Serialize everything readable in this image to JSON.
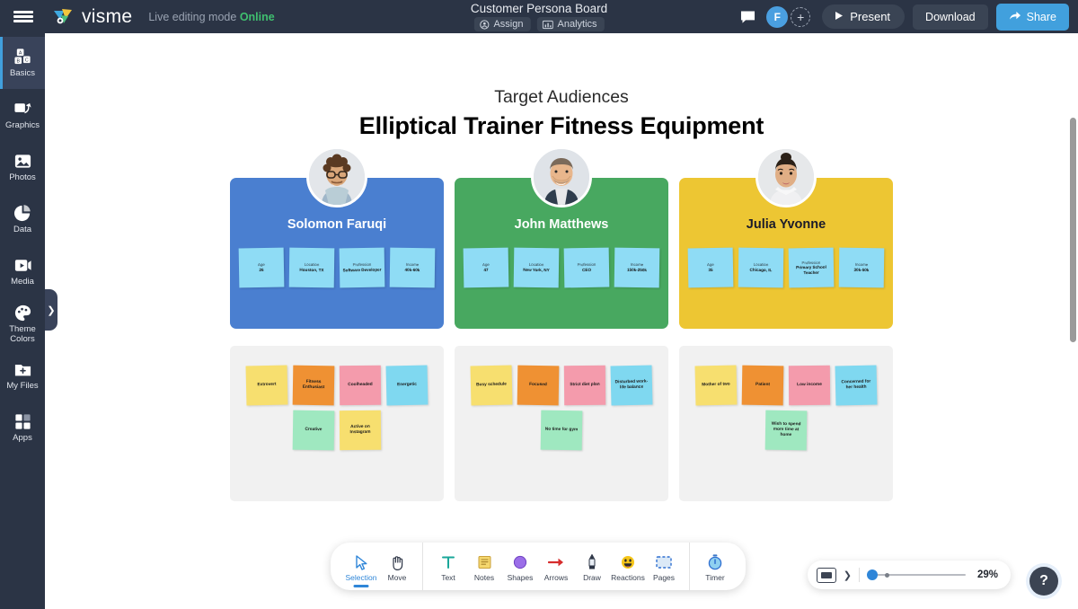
{
  "header": {
    "menu_icon": "hamburger-icon",
    "brand": "visme",
    "live_mode_prefix": "Live editing mode",
    "live_mode_status": "Online",
    "doc_title": "Customer Persona Board",
    "assign_label": "Assign",
    "analytics_label": "Analytics",
    "comment_icon": "comment-icon",
    "avatar_initial": "F",
    "add_user_icon": "add-user-icon",
    "present_label": "Present",
    "download_label": "Download",
    "share_label": "Share",
    "accent_blue": "#41a0dd",
    "bar_color": "#2b3445"
  },
  "sidebar": {
    "items": [
      {
        "label": "Basics",
        "icon": "blocks-icon",
        "active": true
      },
      {
        "label": "Graphics",
        "icon": "graphics-icon",
        "active": false
      },
      {
        "label": "Photos",
        "icon": "photo-icon",
        "active": false
      },
      {
        "label": "Data",
        "icon": "pie-chart-icon",
        "active": false
      },
      {
        "label": "Media",
        "icon": "video-icon",
        "active": false
      },
      {
        "label": "Theme Colors",
        "icon": "palette-icon",
        "active": false
      },
      {
        "label": "My Files",
        "icon": "folder-plus-icon",
        "active": false
      },
      {
        "label": "Apps",
        "icon": "apps-grid-icon",
        "active": false
      }
    ],
    "expand_icon": "chevron-right-icon"
  },
  "board": {
    "subtitle": "Target Audiences",
    "title": "Elliptical Trainer Fitness Equipment",
    "personas": [
      {
        "name": "Solomon Faruqi",
        "color": "#4a7fd0",
        "attributes": [
          {
            "key": "Age",
            "value": "26"
          },
          {
            "key": "Location",
            "value": "Houston, TX"
          },
          {
            "key": "Profession",
            "value": "Software Developer"
          },
          {
            "key": "Income",
            "value": "40k-60k"
          }
        ]
      },
      {
        "name": "John Matthews",
        "color": "#48a860",
        "attributes": [
          {
            "key": "Age",
            "value": "47"
          },
          {
            "key": "Location",
            "value": "New York, NY"
          },
          {
            "key": "Profession",
            "value": "CEO"
          },
          {
            "key": "Income",
            "value": "150k-250k"
          }
        ]
      },
      {
        "name": "Julia Yvonne",
        "color": "#edc633",
        "attributes": [
          {
            "key": "Age",
            "value": "35"
          },
          {
            "key": "Location",
            "value": "Chicago, IL"
          },
          {
            "key": "Profession",
            "value": "Primary School Teacher"
          },
          {
            "key": "Income",
            "value": "30k-50k"
          }
        ]
      }
    ],
    "trait_panels": [
      {
        "traits": [
          {
            "text": "Extrovert",
            "color": "#f7df6f"
          },
          {
            "text": "Fitness Enthusiast",
            "color": "#ef9133"
          },
          {
            "text": "Coolheaded",
            "color": "#f49bac"
          },
          {
            "text": "Energetic",
            "color": "#7fd8f0"
          },
          {
            "text": "Creative",
            "color": "#9fe8c0"
          },
          {
            "text": "Active on Instagram",
            "color": "#f7df6f"
          }
        ]
      },
      {
        "traits": [
          {
            "text": "Busy schedule",
            "color": "#f7df6f"
          },
          {
            "text": "Focused",
            "color": "#ef9133"
          },
          {
            "text": "Strict diet plan",
            "color": "#f49bac"
          },
          {
            "text": "Disturbed work-life balance",
            "color": "#7fd8f0"
          },
          {
            "text": "No time for gym",
            "color": "#9fe8c0"
          }
        ]
      },
      {
        "traits": [
          {
            "text": "Mother of two",
            "color": "#f7df6f"
          },
          {
            "text": "Patient",
            "color": "#ef9133"
          },
          {
            "text": "Low income",
            "color": "#f49bac"
          },
          {
            "text": "Concerned for her health",
            "color": "#7fd8f0"
          },
          {
            "text": "Wish to spend more time at home",
            "color": "#9fe8c0"
          }
        ]
      }
    ]
  },
  "toolbar": {
    "groups": [
      {
        "tools": [
          {
            "label": "Selection",
            "icon": "cursor-icon",
            "active": true
          },
          {
            "label": "Move",
            "icon": "hand-icon",
            "active": false
          }
        ]
      },
      {
        "tools": [
          {
            "label": "Text",
            "icon": "text-t-icon",
            "active": false
          },
          {
            "label": "Notes",
            "icon": "sticky-note-icon",
            "active": false
          },
          {
            "label": "Shapes",
            "icon": "circle-shape-icon",
            "active": false
          },
          {
            "label": "Arrows",
            "icon": "arrow-right-icon",
            "active": false
          },
          {
            "label": "Draw",
            "icon": "pen-icon",
            "active": false
          },
          {
            "label": "Reactions",
            "icon": "emoji-icon",
            "active": false
          },
          {
            "label": "Pages",
            "icon": "pages-icon",
            "active": false
          }
        ]
      },
      {
        "tools": [
          {
            "label": "Timer",
            "icon": "stopwatch-icon",
            "active": false
          }
        ]
      }
    ]
  },
  "zoom_bar": {
    "frame_icon": "frame-icon",
    "caret_icon": "chevron-down-icon",
    "level": "29%",
    "help_label": "?"
  }
}
